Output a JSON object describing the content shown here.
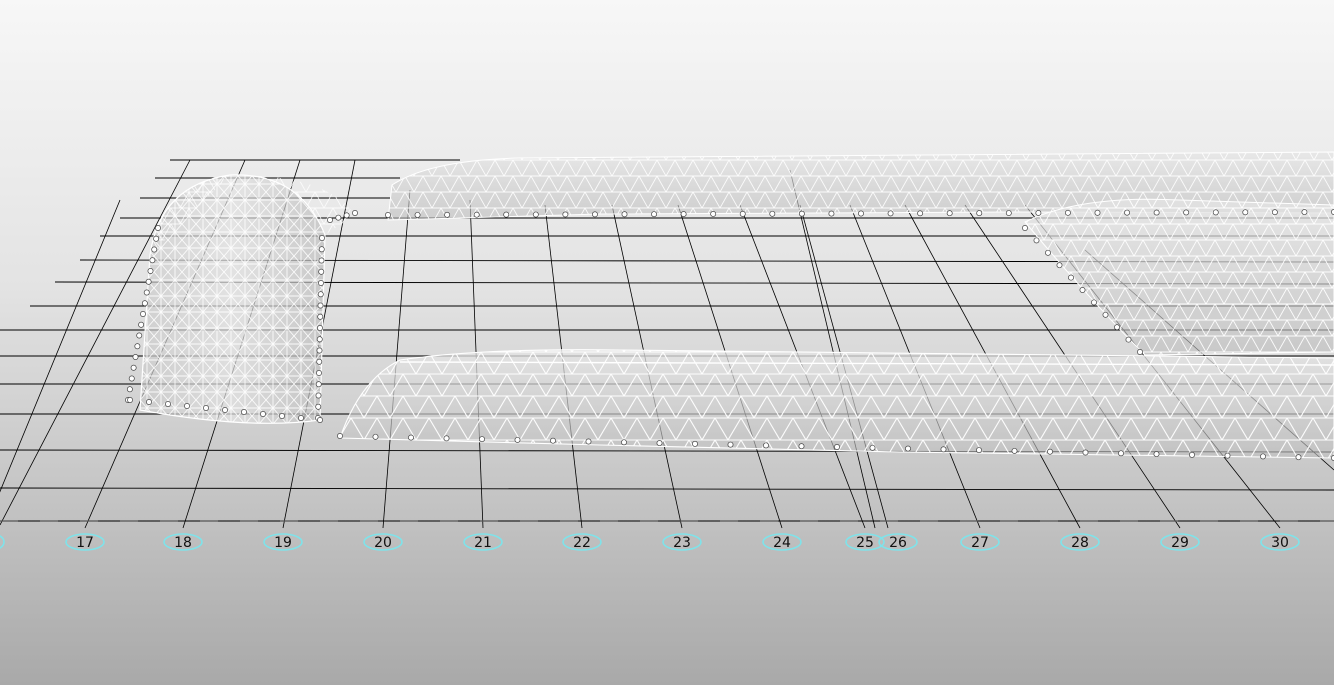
{
  "viewport": {
    "name": "3D structural perspective view",
    "background_top": "#f7f7f7",
    "background_bottom": "#a9a9a9"
  },
  "axis_markers": {
    "labels": [
      "17",
      "18",
      "19",
      "20",
      "21",
      "22",
      "23",
      "24",
      "25",
      "26",
      "27",
      "28",
      "29",
      "30"
    ],
    "bubble_color": "#7fe3ea",
    "text_color": "#111111"
  },
  "colors": {
    "grid_line": "#000000",
    "mesh_line": "#ffffff",
    "mesh_fill": "#cfcfcf",
    "node": "#ffffff"
  }
}
